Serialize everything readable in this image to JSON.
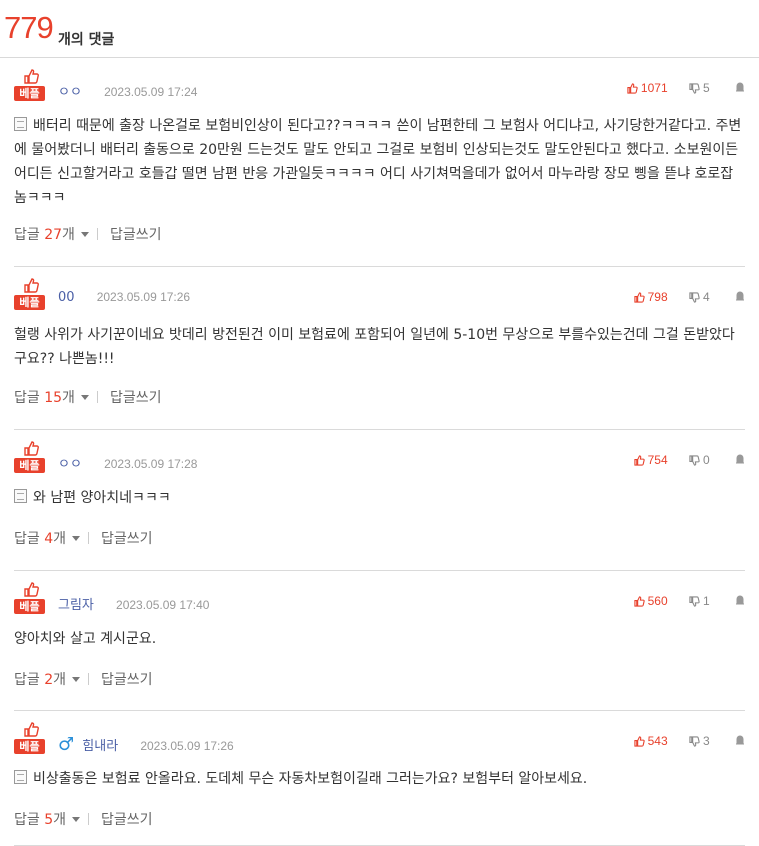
{
  "header": {
    "count": "779",
    "label": "개의 댓글"
  },
  "labels": {
    "best": "베플",
    "reply": "답글",
    "reply_unit": "개",
    "write_reply": "답글쓰기"
  },
  "comments": [
    {
      "author": "ㅇㅇ",
      "gender": "",
      "date": "2023.05.09 17:24",
      "up": "1071",
      "down": "5",
      "has_doc_icon": true,
      "text": "배터리 때문에 출장 나온걸로 보험비인상이 된다고??ㅋㅋㅋㅋ 쓴이 남편한테 그 보험사 어디냐고, 사기당한거같다고. 주변에 물어봤더니 배터리 출동으로 20만원 드는것도 말도 안되고 그걸로 보험비 인상되는것도 말도안된다고 했다고. 소보원이든 어디든 신고할거라고 호들갑 떨면 남편 반응 가관일듯ㅋㅋㅋㅋ 어디 사기쳐먹을데가 없어서 마누라랑 장모 삥을 뜯냐 호로잡놈ㅋㅋㅋ",
      "replies": "27"
    },
    {
      "author": "00",
      "gender": "",
      "date": "2023.05.09 17:26",
      "up": "798",
      "down": "4",
      "has_doc_icon": false,
      "text": "헐랭 사위가 사기꾼이네요 밧데리 방전된건 이미 보험료에 포함되어 일년에 5-10번 무상으로 부를수있는건데 그걸 돈받았다구요?? 나쁜놈!!!",
      "replies": "15"
    },
    {
      "author": "ㅇㅇ",
      "gender": "",
      "date": "2023.05.09 17:28",
      "up": "754",
      "down": "0",
      "has_doc_icon": true,
      "text": "와 남편 양아치네ㅋㅋㅋ",
      "replies": "4"
    },
    {
      "author": "그림자",
      "gender": "",
      "date": "2023.05.09 17:40",
      "up": "560",
      "down": "1",
      "has_doc_icon": false,
      "text": "양아치와 살고 계시군요.",
      "replies": "2"
    },
    {
      "author": "힘내라",
      "gender": "♂",
      "date": "2023.05.09 17:26",
      "up": "543",
      "down": "3",
      "has_doc_icon": true,
      "text": "비상출동은 보험료 안올라요. 도데체 무슨 자동차보험이길래 그러는가요? 보험부터 알아보세요.",
      "replies": "5"
    }
  ]
}
